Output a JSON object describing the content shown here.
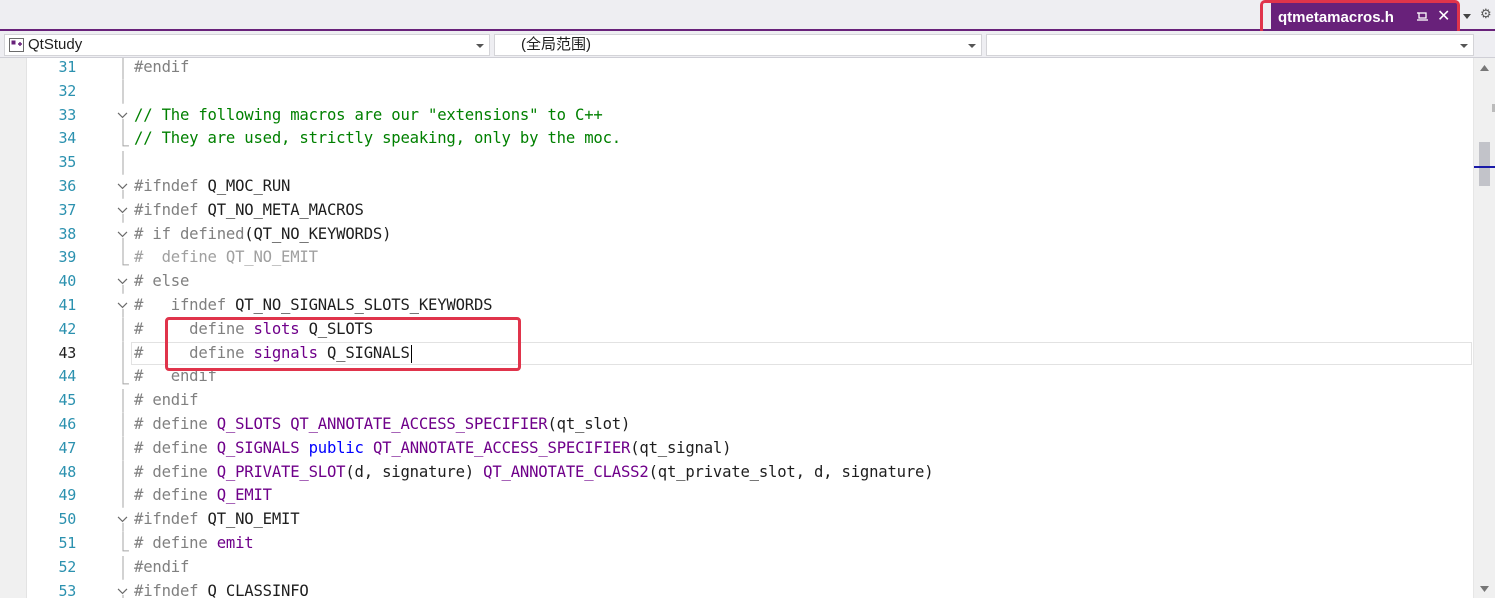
{
  "tab": {
    "title": "qtmetamacros.h"
  },
  "navbar": {
    "project": "QtStudy",
    "scope": "(全局范围)",
    "member": ""
  },
  "editor": {
    "current_line": 43,
    "lines": [
      {
        "num": "31",
        "fold": "line",
        "tokens": [
          {
            "t": "#endif",
            "c": "pp"
          }
        ]
      },
      {
        "num": "32",
        "fold": "line",
        "tokens": []
      },
      {
        "num": "33",
        "fold": "open",
        "tokens": [
          {
            "t": "// The following macros are our \"extensions\" to C++",
            "c": "comment"
          }
        ]
      },
      {
        "num": "34",
        "fold": "end",
        "tokens": [
          {
            "t": "// They are used, strictly speaking, only by the moc.",
            "c": "comment"
          }
        ]
      },
      {
        "num": "35",
        "fold": "line",
        "tokens": []
      },
      {
        "num": "36",
        "fold": "open",
        "tokens": [
          {
            "t": "#ifndef ",
            "c": "pp"
          },
          {
            "t": "Q_MOC_RUN",
            "c": "plain"
          }
        ]
      },
      {
        "num": "37",
        "fold": "open",
        "tokens": [
          {
            "t": "#ifndef ",
            "c": "pp"
          },
          {
            "t": "QT_NO_META_MACROS",
            "c": "plain"
          }
        ]
      },
      {
        "num": "38",
        "fold": "open",
        "tokens": [
          {
            "t": "# if defined",
            "c": "pp"
          },
          {
            "t": "(QT_NO_KEYWORDS)",
            "c": "plain"
          }
        ]
      },
      {
        "num": "39",
        "fold": "end",
        "tokens": [
          {
            "t": "#  define QT_NO_EMIT",
            "c": "inactive"
          }
        ]
      },
      {
        "num": "40",
        "fold": "open",
        "tokens": [
          {
            "t": "# else",
            "c": "pp"
          }
        ]
      },
      {
        "num": "41",
        "fold": "open",
        "tokens": [
          {
            "t": "#   ifndef ",
            "c": "pp"
          },
          {
            "t": "QT_NO_SIGNALS_SLOTS_KEYWORDS",
            "c": "plain"
          }
        ]
      },
      {
        "num": "42",
        "fold": "line",
        "tokens": [
          {
            "t": "#     define ",
            "c": "pp"
          },
          {
            "t": "slots",
            "c": "macro"
          },
          {
            "t": " Q_SLOTS",
            "c": "plain"
          }
        ]
      },
      {
        "num": "43",
        "fold": "line",
        "tokens": [
          {
            "t": "#     define ",
            "c": "pp"
          },
          {
            "t": "signals",
            "c": "macro"
          },
          {
            "t": " Q_SIGNALS",
            "c": "plain"
          }
        ]
      },
      {
        "num": "44",
        "fold": "end",
        "tokens": [
          {
            "t": "#   endif",
            "c": "pp"
          }
        ]
      },
      {
        "num": "45",
        "fold": "line",
        "tokens": [
          {
            "t": "# endif",
            "c": "pp"
          }
        ]
      },
      {
        "num": "46",
        "fold": "line",
        "tokens": [
          {
            "t": "# define ",
            "c": "pp"
          },
          {
            "t": "Q_SLOTS QT_ANNOTATE_ACCESS_SPECIFIER",
            "c": "macro"
          },
          {
            "t": "(qt_slot)",
            "c": "plain"
          }
        ]
      },
      {
        "num": "47",
        "fold": "line",
        "tokens": [
          {
            "t": "# define ",
            "c": "pp"
          },
          {
            "t": "Q_SIGNALS ",
            "c": "macro"
          },
          {
            "t": "public",
            "c": "kw"
          },
          {
            "t": " ",
            "c": "plain"
          },
          {
            "t": "QT_ANNOTATE_ACCESS_SPECIFIER",
            "c": "macro"
          },
          {
            "t": "(qt_signal)",
            "c": "plain"
          }
        ]
      },
      {
        "num": "48",
        "fold": "line",
        "tokens": [
          {
            "t": "# define ",
            "c": "pp"
          },
          {
            "t": "Q_PRIVATE_SLOT",
            "c": "macro"
          },
          {
            "t": "(d, signature) ",
            "c": "plain"
          },
          {
            "t": "QT_ANNOTATE_CLASS2",
            "c": "macro"
          },
          {
            "t": "(qt_private_slot, d, signature)",
            "c": "plain"
          }
        ]
      },
      {
        "num": "49",
        "fold": "line",
        "tokens": [
          {
            "t": "# define ",
            "c": "pp"
          },
          {
            "t": "Q_EMIT",
            "c": "macro"
          }
        ]
      },
      {
        "num": "50",
        "fold": "open",
        "tokens": [
          {
            "t": "#ifndef ",
            "c": "pp"
          },
          {
            "t": "QT_NO_EMIT",
            "c": "plain"
          }
        ]
      },
      {
        "num": "51",
        "fold": "end",
        "tokens": [
          {
            "t": "# define ",
            "c": "pp"
          },
          {
            "t": "emit",
            "c": "macro"
          }
        ]
      },
      {
        "num": "52",
        "fold": "line",
        "tokens": [
          {
            "t": "#endif",
            "c": "pp"
          }
        ]
      },
      {
        "num": "53",
        "fold": "open",
        "tokens": [
          {
            "t": "#ifndef ",
            "c": "pp"
          },
          {
            "t": "Q_CLASSINFO",
            "c": "plain"
          }
        ]
      }
    ]
  },
  "colors": {
    "accent": "#68217a",
    "highlight_box": "#e0344b",
    "comment": "#008000",
    "preprocessor": "#808080",
    "macro": "#6f008a",
    "keyword": "#0000ff",
    "line_number": "#2b91af"
  },
  "icons": {
    "tab_pin": "pin-icon",
    "tab_close": "close-icon",
    "tab_list": "chevron-down-icon",
    "settings": "gear-icon",
    "project": "project-icon",
    "split": "split-editor-icon"
  }
}
